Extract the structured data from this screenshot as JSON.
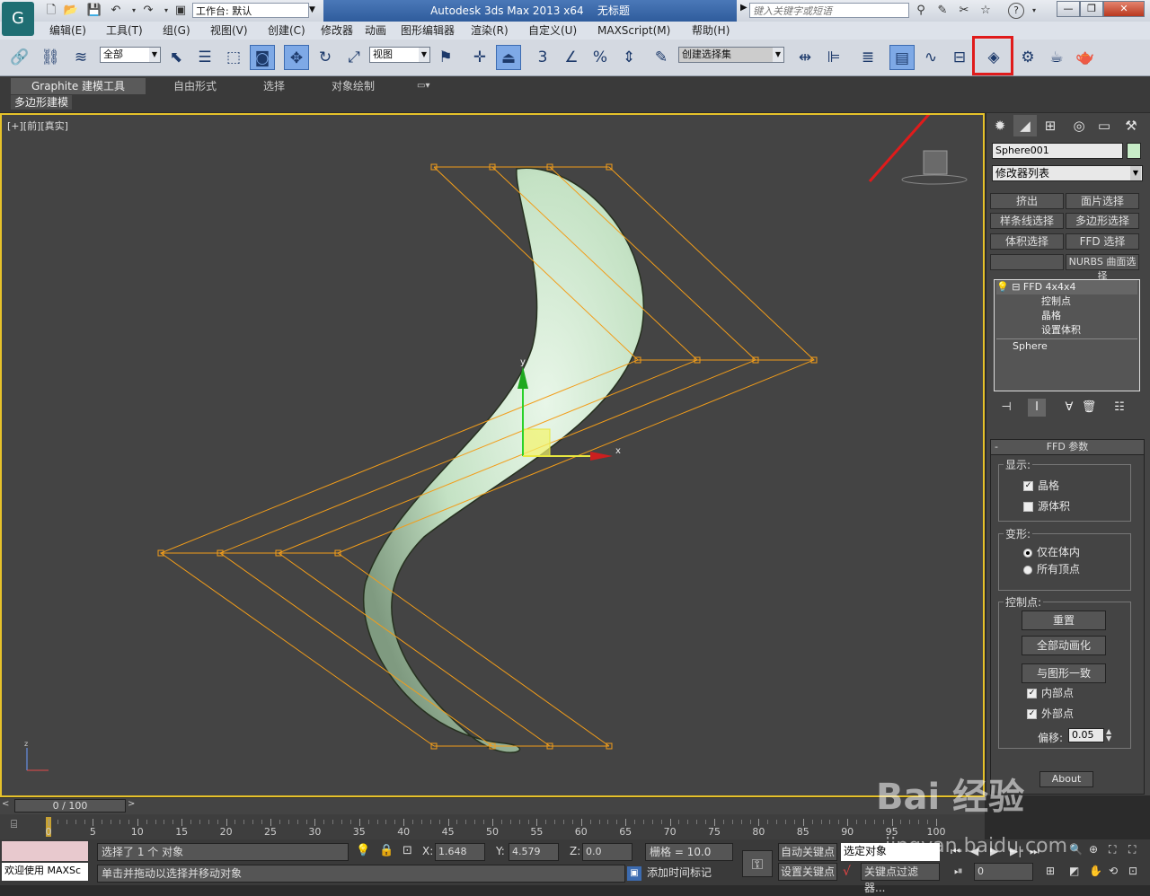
{
  "titlebar": {
    "workspace_label": "工作台: 默认",
    "title": "Autodesk 3ds Max  2013 x64",
    "filename": "无标题",
    "search_placeholder": "键入关键字或短语",
    "minimize": "—",
    "restore": "❐",
    "close": "✕"
  },
  "menu": [
    "编辑(E)",
    "工具(T)",
    "组(G)",
    "视图(V)",
    "创建(C)",
    "修改器",
    "动画",
    "图形编辑器",
    "渲染(R)",
    "自定义(U)",
    "MAXScript(M)",
    "帮助(H)"
  ],
  "toolbar": {
    "selection_filter": "全部",
    "ref_coord": "视图",
    "named_selection": "创建选择集",
    "percent_snap": "%",
    "angle_snap_label": "3"
  },
  "ribbon": {
    "tabs": [
      "Graphite 建模工具",
      "自由形式",
      "选择",
      "对象绘制"
    ],
    "subtab": "多边形建模"
  },
  "viewport": {
    "label": "[+][前][真实]",
    "gizmo_x_label": "x",
    "gizmo_y_label": "y",
    "axis_z": "z",
    "object_color": "#cfe8cf",
    "lattice_color": "#f29d1a"
  },
  "command_panel": {
    "object_name": "Sphere001",
    "modifier_list": "修改器列表",
    "quick_buttons": [
      "挤出",
      "面片选择",
      "样条线选择",
      "多边形选择",
      "体积选择",
      "FFD 选择",
      "",
      "NURBS 曲面选择"
    ],
    "stack": {
      "top": "FFD 4x4x4",
      "subs": [
        "控制点",
        "晶格",
        "设置体积"
      ],
      "base": "Sphere"
    },
    "rollout": {
      "title": "FFD 参数",
      "display_label": "显示:",
      "lattice": "晶格",
      "source_volume": "源体积",
      "deform_label": "变形:",
      "only_in_volume": "仅在体内",
      "all_vertices": "所有顶点",
      "control_points_label": "控制点:",
      "reset": "重置",
      "animate_all": "全部动画化",
      "conform": "与图形一致",
      "inside_points": "内部点",
      "outside_points": "外部点",
      "offset_label": "偏移:",
      "offset_value": "0.05",
      "about": "About"
    }
  },
  "timeline": {
    "frame_display": "0 / 100",
    "ticks": [
      "0",
      "5",
      "10",
      "15",
      "20",
      "25",
      "30",
      "35",
      "40",
      "45",
      "50",
      "55",
      "60",
      "65",
      "70",
      "75",
      "80",
      "85",
      "90",
      "95",
      "100"
    ]
  },
  "status": {
    "maxscript_welcome": "欢迎使用 MAXSc",
    "selected": "选择了 1 个 对象",
    "prompt": "单击并拖动以选择并移动对象",
    "x_label": "X:",
    "x_value": "1.648",
    "y_label": "Y:",
    "y_value": "4.579",
    "z_label": "Z:",
    "z_value": "0.0",
    "grid": "栅格 = 10.0",
    "add_time_tag": "添加时间标记",
    "auto_key": "自动关键点",
    "selected_objects": "选定对象",
    "set_key": "设置关键点",
    "key_filters": "关键点过滤器...",
    "frame": "0"
  },
  "watermark": {
    "brand": "Bai 经验",
    "url": "jingyan.baidu.com"
  }
}
